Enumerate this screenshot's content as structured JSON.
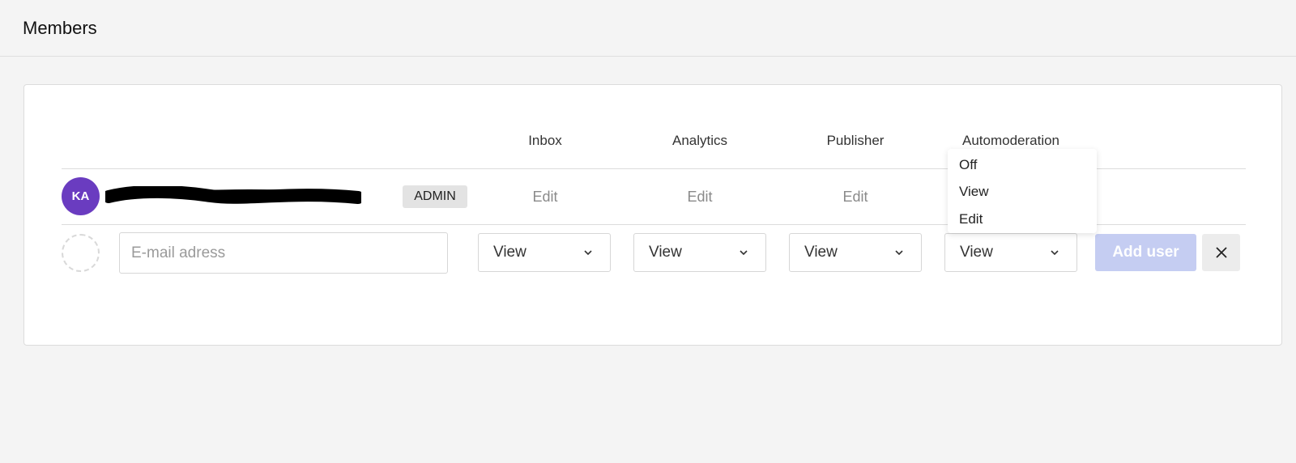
{
  "header": {
    "title": "Members"
  },
  "columns": [
    "Inbox",
    "Analytics",
    "Publisher",
    "Automoderation"
  ],
  "member": {
    "initials": "KA",
    "role_badge": "ADMIN",
    "permissions": [
      "Edit",
      "Edit",
      "Edit"
    ]
  },
  "new_member": {
    "email_placeholder": "E-mail adress",
    "selects": [
      "View",
      "View",
      "View",
      "View"
    ],
    "add_button": "Add user"
  },
  "dropdown": {
    "options": [
      "Off",
      "View",
      "Edit"
    ]
  },
  "colors": {
    "avatar": "#6a3cc0",
    "add_button": "#c5cdf2",
    "badge_bg": "#e3e3e3"
  },
  "icons": {
    "select_chevron": "chevron-down-icon",
    "close": "close-icon"
  }
}
